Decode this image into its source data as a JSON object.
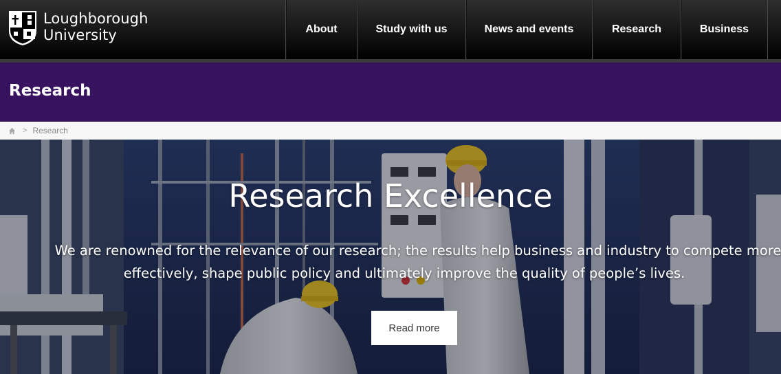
{
  "header": {
    "logo": {
      "line1": "Loughborough",
      "line2": "University"
    },
    "nav": [
      {
        "label": "About"
      },
      {
        "label": "Study with us"
      },
      {
        "label": "News and events"
      },
      {
        "label": "Research"
      },
      {
        "label": "Business"
      }
    ]
  },
  "banner": {
    "title": "Research"
  },
  "breadcrumb": {
    "home_icon": "home-icon",
    "separator": ">",
    "current": "Research"
  },
  "hero": {
    "title": "Research Excellence",
    "text_line1": "We are renowned for the relevance of our research; the results help business and industry to compete more",
    "text_line2": "effectively, shape public policy and ultimately improve the quality of people’s lives.",
    "button_label": "Read more"
  },
  "colors": {
    "header_bg": "#000000",
    "banner_bg": "#37125f",
    "breadcrumb_bg": "#f7f7f7",
    "hero_tint": "#1d2a47"
  }
}
